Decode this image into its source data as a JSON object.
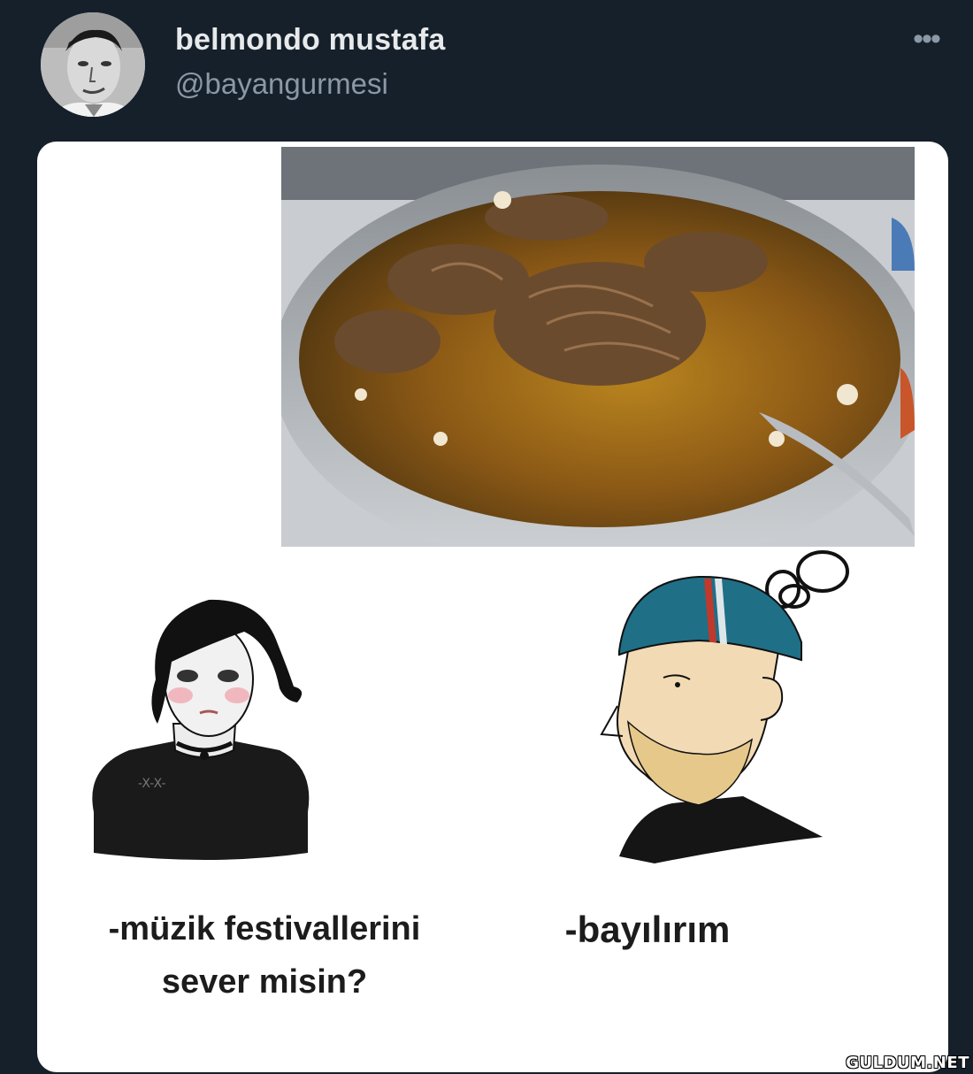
{
  "tweet": {
    "display_name": "belmondo mustafa",
    "handle": "@bayangurmesi",
    "more_icon": "more-horizontal-icon",
    "more_label": "•••"
  },
  "meme": {
    "caption_left_line1": "-müzik festivallerini",
    "caption_left_line2": "sever misin?",
    "caption_right": "-bayılırım"
  },
  "watermark": "GULDUM.NET"
}
